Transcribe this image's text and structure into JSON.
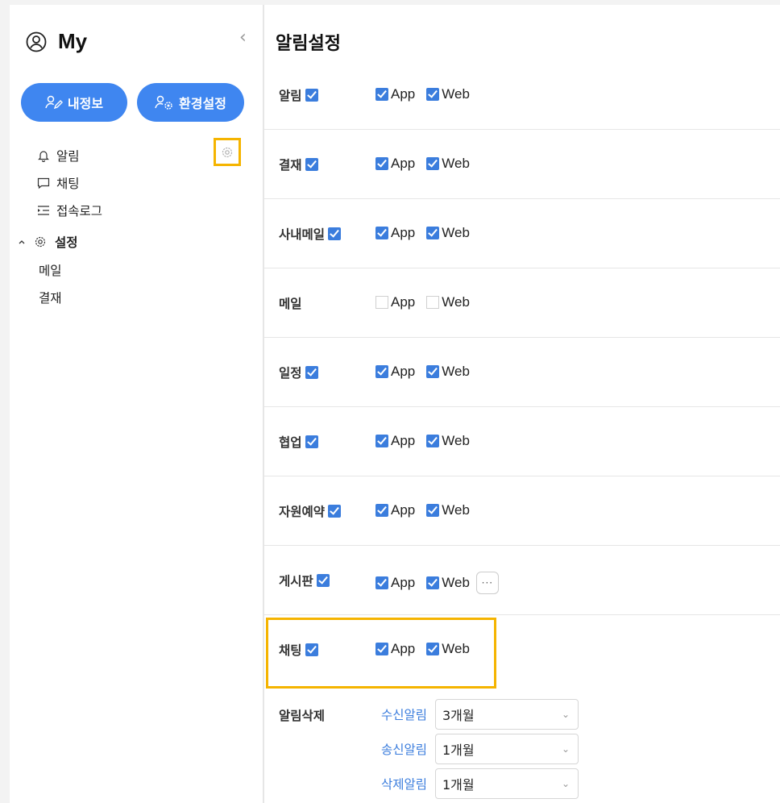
{
  "sidebar": {
    "title": "My",
    "buttons": {
      "profile_label": "내정보",
      "env_label": "환경설정"
    },
    "nav": [
      {
        "label": "알림",
        "icon": "bell-icon"
      },
      {
        "label": "채팅",
        "icon": "chat-icon"
      },
      {
        "label": "접속로그",
        "icon": "log-icon"
      }
    ],
    "settings": {
      "label": "설정",
      "children": [
        "메일",
        "결재"
      ]
    }
  },
  "main": {
    "title": "알림설정",
    "app_label": "App",
    "web_label": "Web",
    "rows": [
      {
        "label": "알림",
        "enabled": true,
        "app": true,
        "web": true
      },
      {
        "label": "결재",
        "enabled": true,
        "app": true,
        "web": true
      },
      {
        "label": "사내메일",
        "enabled": true,
        "app": true,
        "web": true
      },
      {
        "label": "메일",
        "enabled": false,
        "app": false,
        "web": false
      },
      {
        "label": "일정",
        "enabled": true,
        "app": true,
        "web": true
      },
      {
        "label": "협업",
        "enabled": true,
        "app": true,
        "web": true
      },
      {
        "label": "자원예약",
        "enabled": true,
        "app": true,
        "web": true
      },
      {
        "label": "게시판",
        "enabled": true,
        "app": true,
        "web": true,
        "more": "···"
      },
      {
        "label": "채팅",
        "enabled": true,
        "app": true,
        "web": true
      }
    ],
    "delete": {
      "label": "알림삭제",
      "items": [
        {
          "name": "수신알림",
          "value": "3개월"
        },
        {
          "name": "송신알림",
          "value": "1개월"
        },
        {
          "name": "삭제알림",
          "value": "1개월"
        }
      ]
    }
  },
  "colors": {
    "accent": "#3f86f0",
    "highlight": "#f5b400",
    "checkbox": "#3b7ddd"
  }
}
